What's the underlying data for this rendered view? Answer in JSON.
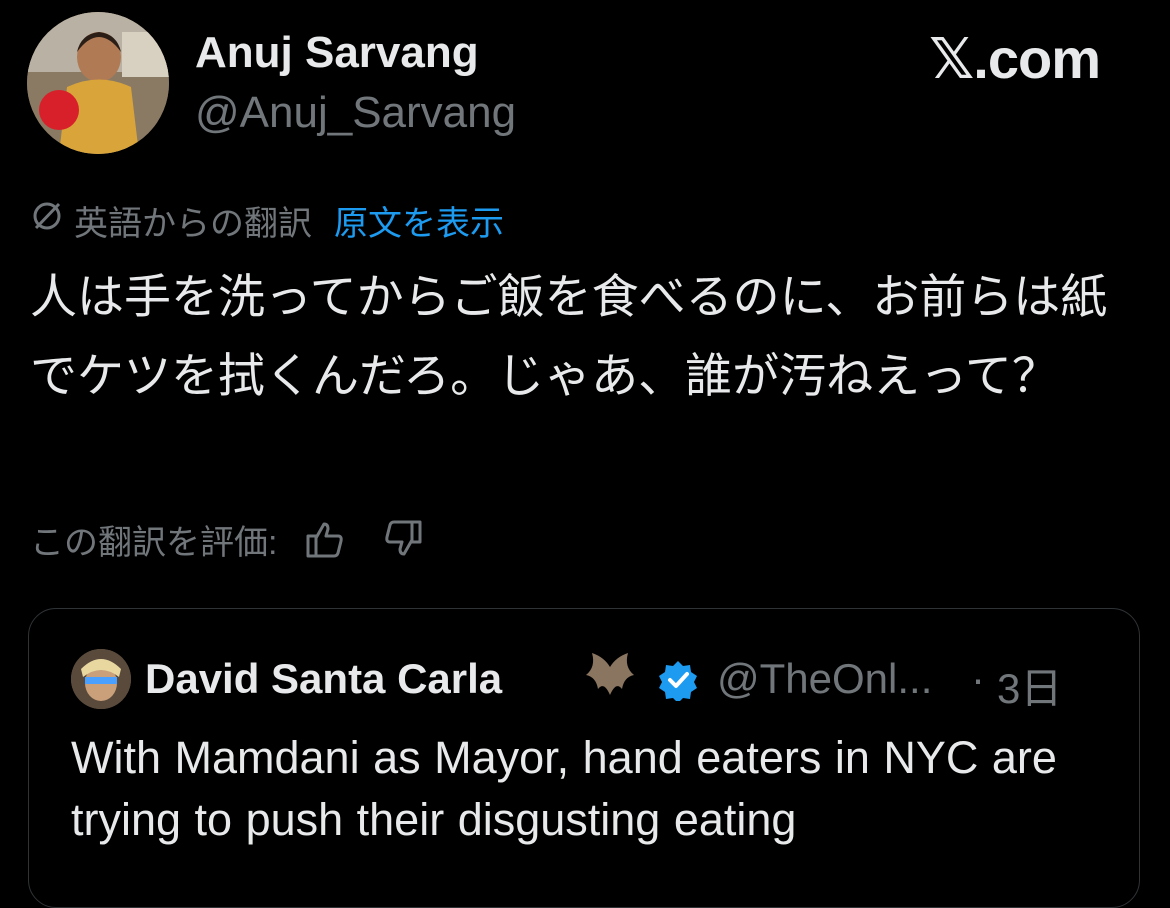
{
  "author": {
    "name": "Anuj Sarvang",
    "handle": "@Anuj_Sarvang"
  },
  "brand": "𝕏.com",
  "translation": {
    "label": "英語からの翻訳",
    "show_original": "原文を表示"
  },
  "tweet_text": "人は手を洗ってからご飯を食べるのに、お前らは紙でケツを拭くんだろ。じゃあ、誰が汚ねえって？",
  "rating": {
    "label": "この翻訳を評価:"
  },
  "quote": {
    "name": "David Santa Carla",
    "handle": "@TheOnl...",
    "separator": "·",
    "time": "3日",
    "text": "With Mamdani as Mayor, hand eaters in NYC are trying to push their disgusting eating"
  },
  "colors": {
    "background": "#000000",
    "text": "#e7e9ea",
    "muted": "#71767b",
    "link": "#1d9bf0",
    "verified": "#1d9bf0",
    "border": "#2f3336"
  },
  "icons": [
    "translate-icon",
    "thumbs-up-icon",
    "thumbs-down-icon",
    "bat-emoji-icon",
    "verified-badge-icon"
  ]
}
